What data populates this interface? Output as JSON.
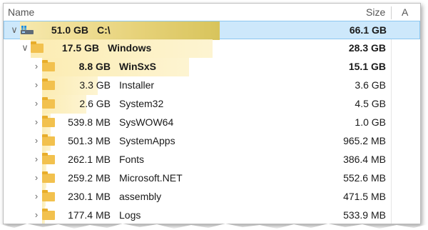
{
  "header": {
    "name_label": "Name",
    "size_label": "Size",
    "extra_label": "A"
  },
  "rows": [
    {
      "size": "51.0 GB",
      "name": "C:\\",
      "total": "66.1 GB",
      "type": "drive",
      "bold": true,
      "selected": true,
      "fill": 0.68
    },
    {
      "size": "17.5 GB",
      "name": "Windows",
      "total": "28.3 GB",
      "type": "folder",
      "bold": true,
      "expanded": true,
      "fill": 0.62
    },
    {
      "size": "8.8 GB",
      "name": "WinSxS",
      "total": "15.1 GB",
      "type": "folder",
      "bold": true,
      "fill": 0.5
    },
    {
      "size": "3.3 GB",
      "name": "Installer",
      "total": "3.6 GB",
      "type": "folder",
      "fill": 0.19
    },
    {
      "size": "2.6 GB",
      "name": "System32",
      "total": "4.5 GB",
      "type": "folder",
      "fill": 0.15
    },
    {
      "size": "539.8 MB",
      "name": "SysWOW64",
      "total": "1.0 GB",
      "type": "folder",
      "fill": 0.03
    },
    {
      "size": "501.3 MB",
      "name": "SystemApps",
      "total": "965.2 MB",
      "type": "folder",
      "fill": 0.03
    },
    {
      "size": "262.1 MB",
      "name": "Fonts",
      "total": "386.4 MB",
      "type": "folder",
      "fill": 0.015
    },
    {
      "size": "259.2 MB",
      "name": "Microsoft.NET",
      "total": "552.6 MB",
      "type": "folder",
      "fill": 0.015
    },
    {
      "size": "230.1 MB",
      "name": "assembly",
      "total": "471.5 MB",
      "type": "folder",
      "fill": 0.013
    },
    {
      "size": "177.4 MB",
      "name": "Logs",
      "total": "533.9 MB",
      "type": "folder",
      "fill": 0.01
    }
  ],
  "colors": {
    "fill_strong": "#d9c04a",
    "fill_soft": "#fbe9a6",
    "selected_bg": "#cde8fb"
  }
}
